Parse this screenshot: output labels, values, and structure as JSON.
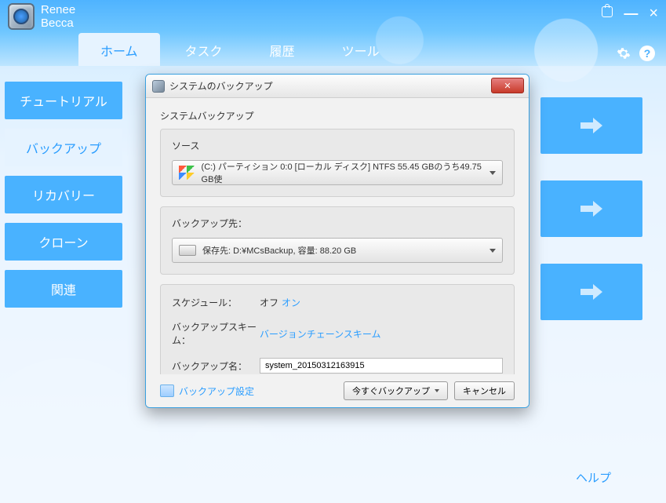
{
  "app": {
    "title_line1": "Renee",
    "title_line2": "Becca"
  },
  "tabs": {
    "home": "ホーム",
    "task": "タスク",
    "history": "履歴",
    "tool": "ツール"
  },
  "sidebar": {
    "tutorial": "チュートリアル",
    "backup": "バックアップ",
    "recovery": "リカバリー",
    "clone": "クローン",
    "related": "関連"
  },
  "help_link": "ヘルプ",
  "dialog": {
    "title": "システムのバックアップ",
    "section_title": "システムバックアップ",
    "source_label": "ソース",
    "source_value": "(C:) パーティション 0:0 [ローカル ディスク]   NTFS    55.45 GBのうち49.75 GB使",
    "dest_label": "バックアップ先：",
    "dest_value": "保存先: D:¥MCsBackup, 容量: 88.20 GB",
    "schedule_label": "スケジュール：",
    "schedule_off": "オフ",
    "schedule_on": "オン",
    "scheme_label": "バックアップスキーム：",
    "scheme_link": "バージョンチェーンスキーム",
    "name_label": "バックアップ名：",
    "name_value": "system_20150312163915",
    "settings_link": "バックアップ設定",
    "btn_backup_now": "今すぐバックアップ",
    "btn_cancel": "キャンセル"
  }
}
